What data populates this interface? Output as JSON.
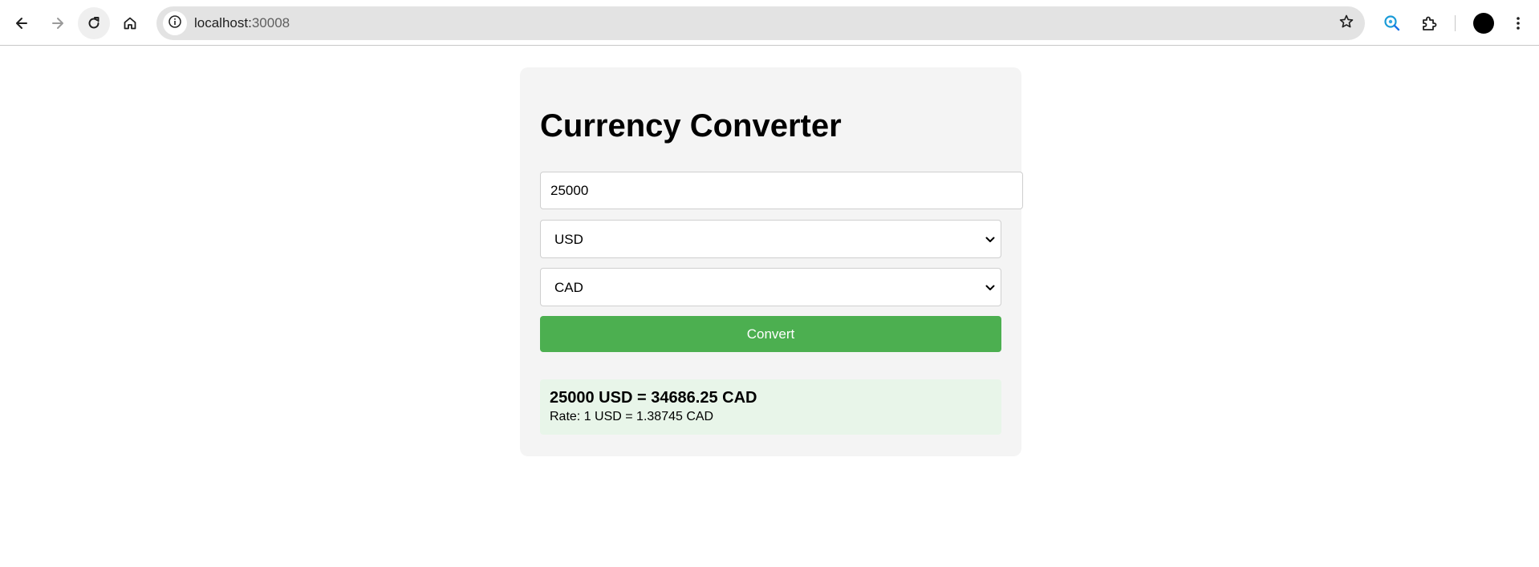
{
  "browser": {
    "url_host": "localhost:",
    "url_port": "30008",
    "accent_color": "#1a73e8"
  },
  "converter": {
    "title": "Currency Converter",
    "amount_value": "25000",
    "from_currency": "USD",
    "to_currency": "CAD",
    "convert_label": "Convert",
    "result_text": "25000 USD = 34686.25 CAD",
    "rate_text": "Rate: 1 USD = 1.38745 CAD",
    "button_color": "#4caf50",
    "result_bg_color": "#e8f5e9"
  },
  "icons": {
    "back": "back-arrow-icon",
    "forward": "forward-arrow-icon",
    "reload": "reload-icon",
    "home": "home-icon",
    "site_info": "info-icon",
    "bookmark": "star-icon",
    "lens": "search-lens-icon",
    "extensions": "puzzle-icon",
    "menu": "kebab-menu-icon"
  }
}
